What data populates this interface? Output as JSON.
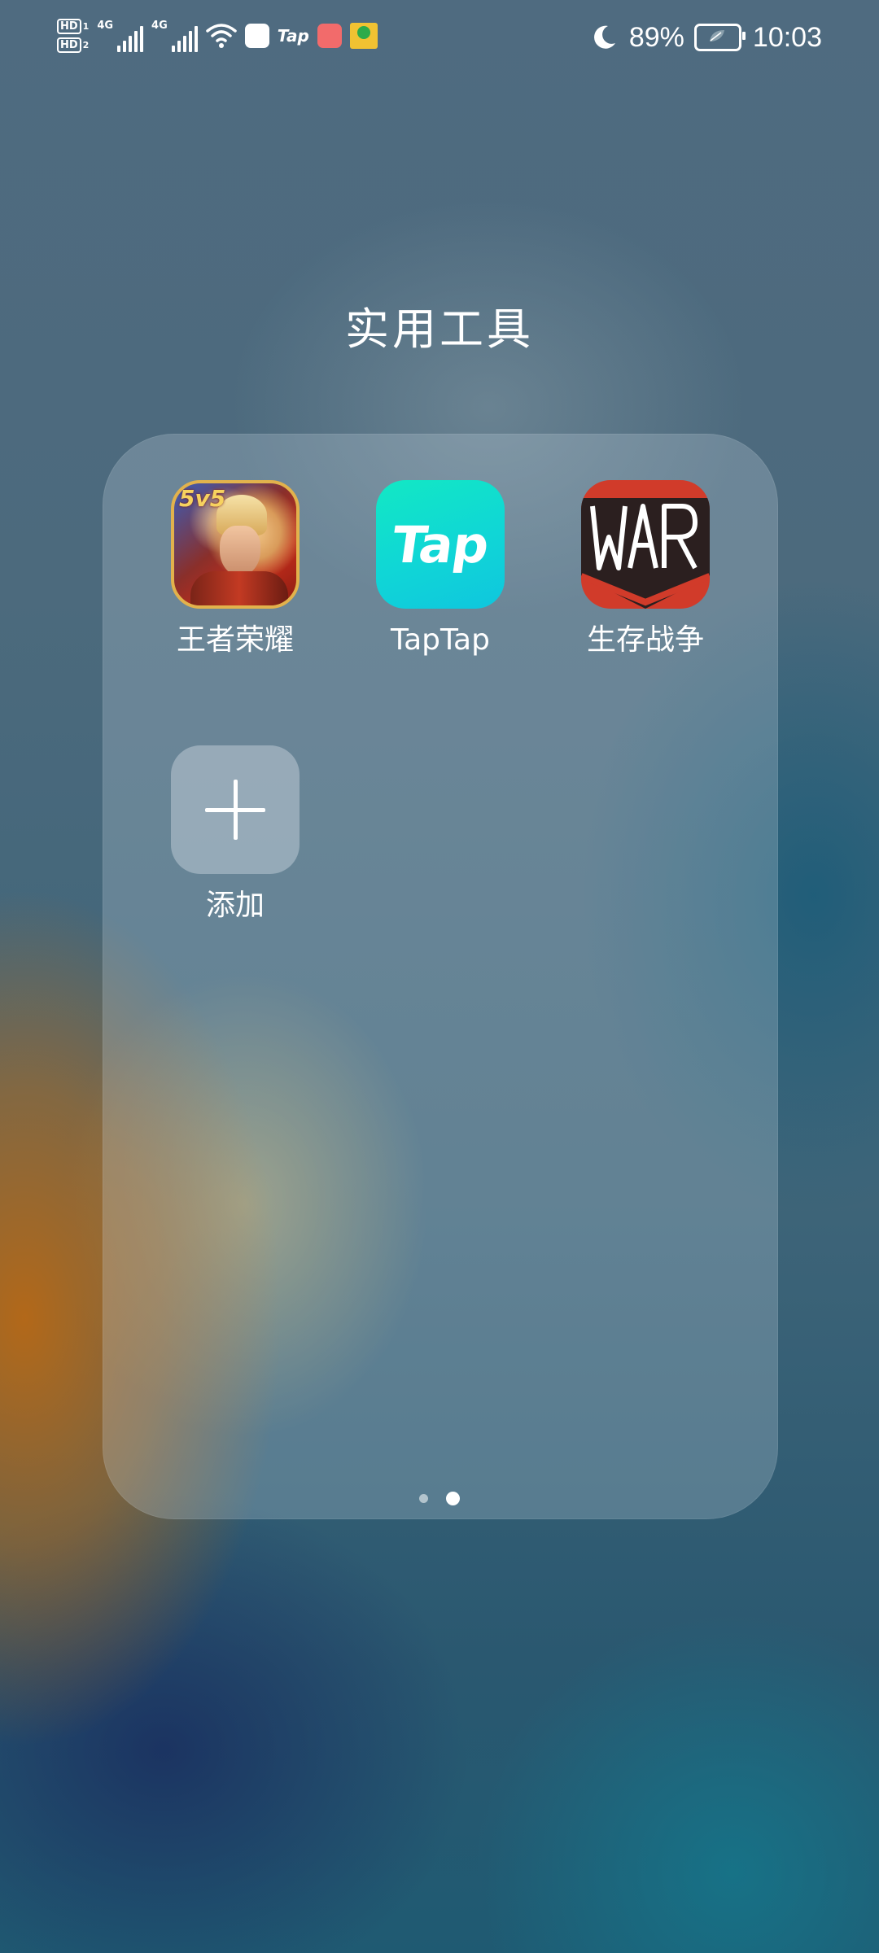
{
  "status_bar": {
    "hd1": "HD",
    "hd1_num": "1",
    "hd2": "HD",
    "hd2_num": "2",
    "sim1_network": "4G",
    "sim2_network": "4G",
    "notification_tap": "Tap",
    "battery_percent": "89%",
    "battery_level": 0.89,
    "time": "10:03"
  },
  "folder": {
    "title": "实用工具",
    "apps": [
      {
        "label": "王者荣耀",
        "icon": "honor-of-kings-icon",
        "badge_text": "5v5"
      },
      {
        "label": "TapTap",
        "icon": "taptap-icon",
        "wordmark": "Tap",
        "color": "#12e0cc"
      },
      {
        "label": "生存战争",
        "icon": "survivalcraft-war-icon",
        "wordmark": "WAR",
        "color": "#d13b2a"
      },
      {
        "label": "添加",
        "icon": "plus-icon"
      }
    ],
    "pages": {
      "count": 2,
      "active_index": 1
    }
  }
}
